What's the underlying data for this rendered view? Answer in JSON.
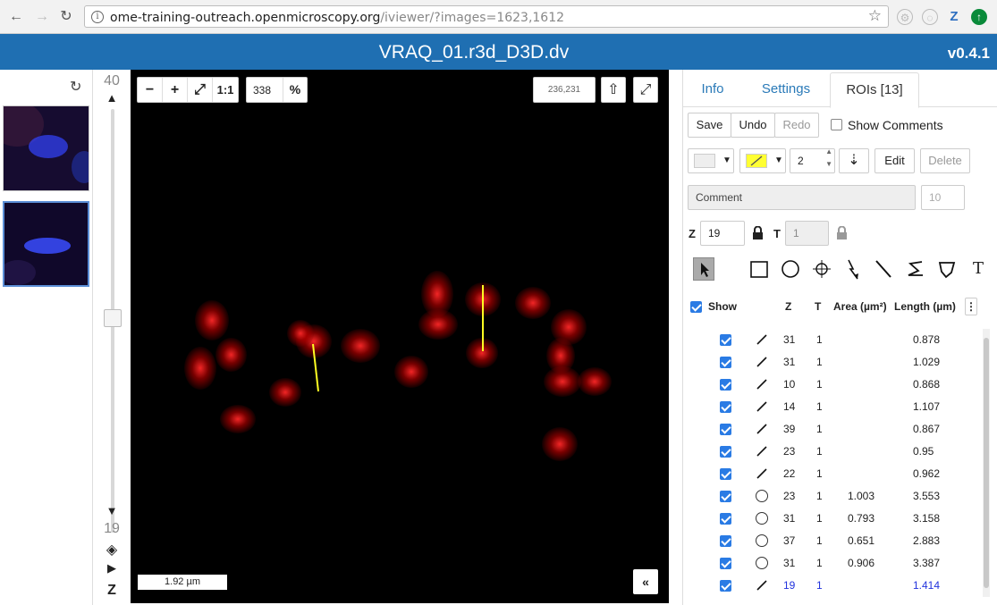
{
  "browser": {
    "url_host": "ome-training-outreach.openmicroscopy.org",
    "url_path": "/iviewer/?images=1623,1612",
    "ext_z": "Z"
  },
  "header": {
    "title": "VRAQ_01.r3d_D3D.dv",
    "version": "v0.4.1"
  },
  "zslider": {
    "max": "40",
    "current": "19",
    "z_label": "Z",
    "position_fraction": 0.53
  },
  "toolbar": {
    "zoom_out": "−",
    "zoom_in": "+",
    "one_to_one": "1:1",
    "zoom_value": "338",
    "zoom_unit": "%",
    "coords": "236,231"
  },
  "viewer": {
    "scalebar": "1.92 µm",
    "collapse": "«"
  },
  "tabs": [
    {
      "label": "Info"
    },
    {
      "label": "Settings"
    },
    {
      "label": "ROIs [13]"
    }
  ],
  "roi": {
    "save": "Save",
    "undo": "Undo",
    "redo": "Redo",
    "show_comments": "Show Comments",
    "stroke_width": "2",
    "edit": "Edit",
    "delete": "Delete",
    "comment_placeholder": "Comment",
    "font_size": "10",
    "z_label": "Z",
    "z_value": "19",
    "t_label": "T",
    "t_value": "1",
    "fill_color": "#eeeeee",
    "stroke_color": "#ffff33",
    "text_tool": "T"
  },
  "table": {
    "headers": {
      "show": "Show",
      "z": "Z",
      "t": "T",
      "area": "Area (µm²)",
      "length": "Length (µm)"
    },
    "rows": [
      {
        "shape": "line",
        "z": "31",
        "t": "1",
        "area": "",
        "length": "0.878"
      },
      {
        "shape": "line",
        "z": "31",
        "t": "1",
        "area": "",
        "length": "1.029"
      },
      {
        "shape": "line",
        "z": "10",
        "t": "1",
        "area": "",
        "length": "0.868"
      },
      {
        "shape": "line",
        "z": "14",
        "t": "1",
        "area": "",
        "length": "1.107"
      },
      {
        "shape": "line",
        "z": "39",
        "t": "1",
        "area": "",
        "length": "0.867"
      },
      {
        "shape": "line",
        "z": "23",
        "t": "1",
        "area": "",
        "length": "0.95"
      },
      {
        "shape": "line",
        "z": "22",
        "t": "1",
        "area": "",
        "length": "0.962"
      },
      {
        "shape": "ellipse",
        "z": "23",
        "t": "1",
        "area": "1.003",
        "length": "3.553"
      },
      {
        "shape": "ellipse",
        "z": "31",
        "t": "1",
        "area": "0.793",
        "length": "3.158"
      },
      {
        "shape": "ellipse",
        "z": "37",
        "t": "1",
        "area": "0.651",
        "length": "2.883"
      },
      {
        "shape": "ellipse",
        "z": "31",
        "t": "1",
        "area": "0.906",
        "length": "3.387"
      },
      {
        "shape": "line",
        "z": "19",
        "t": "1",
        "area": "",
        "length": "1.414",
        "current": true
      }
    ]
  }
}
